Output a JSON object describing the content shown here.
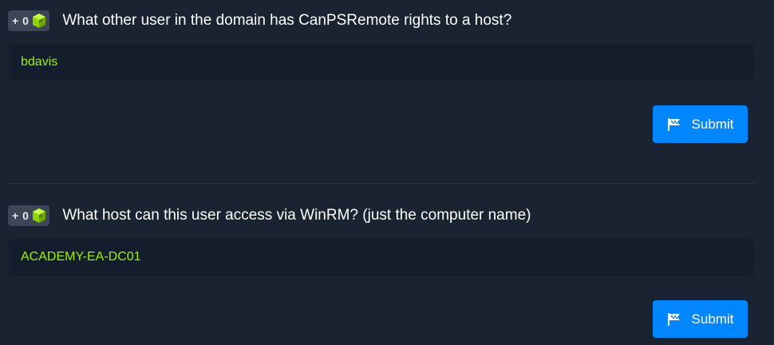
{
  "questions": [
    {
      "points": "+ 0",
      "cube_icon": "cube-icon",
      "question": "What other user in the domain has CanPSRemote rights to a host?",
      "answer": "bdavis",
      "submit_label": "Submit",
      "submit_icon": "flag-icon"
    },
    {
      "points": "+ 0",
      "cube_icon": "cube-icon",
      "question": "What host can this user access via WinRM? (just the computer name)",
      "answer": "ACADEMY-EA-DC01",
      "submit_label": "Submit",
      "submit_icon": "flag-icon"
    }
  ],
  "colors": {
    "background": "#1a2332",
    "answer_box": "#141d2b",
    "answer_text": "#9fef00",
    "submit_button": "#0086ff",
    "badge": "#3c4656",
    "cube_green": "#9fef00"
  }
}
